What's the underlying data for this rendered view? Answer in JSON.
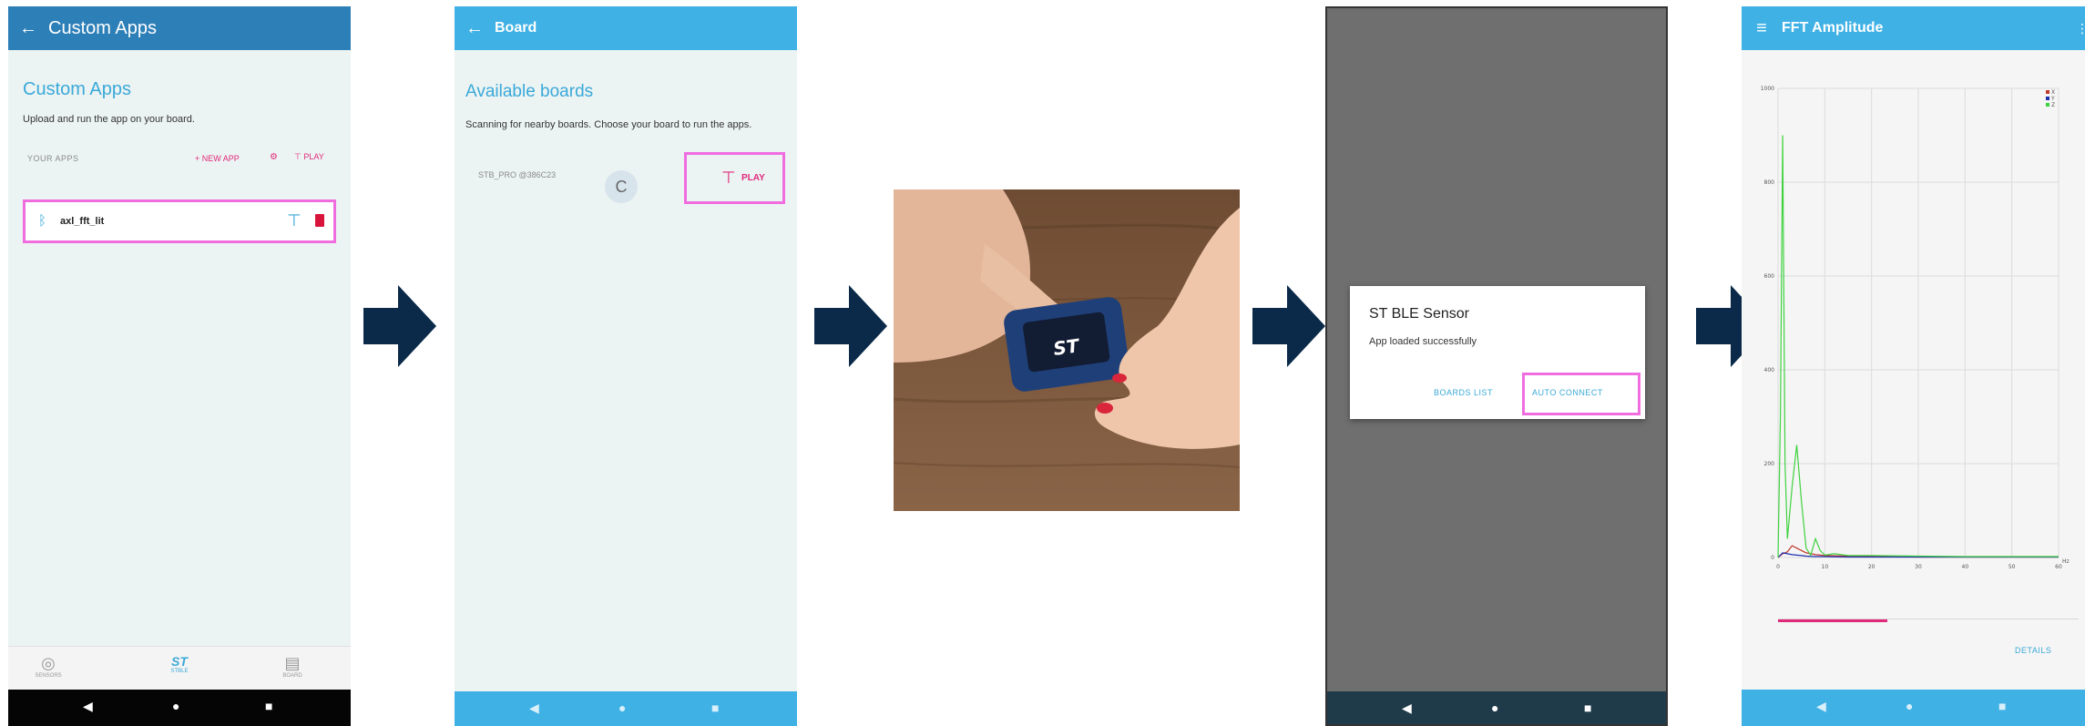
{
  "flow_arrow_color": "#0b2a4a",
  "panel1": {
    "appbar_title": "Custom Apps",
    "back_icon": "←",
    "heading": "Custom Apps",
    "subtitle": "Upload and run the app on your board.",
    "section_label": "YOUR APPS",
    "new_app_label": "+ NEW APP",
    "play_label": "PLAY",
    "app_name": "axl_fft_lit",
    "nav_items": [
      "SENSORS",
      "STBLE",
      "BOARD"
    ],
    "nav_active_label": "ST"
  },
  "panel2": {
    "appbar_title": "Board",
    "back_icon": "←",
    "heading": "Available boards",
    "subtitle": "Scanning for nearby boards. Choose your board to run the apps.",
    "board_name": "STB_PRO @386C23",
    "spinner_glyph": "C",
    "play_label": "PLAY"
  },
  "panel4": {
    "dialog_title": "ST BLE Sensor",
    "dialog_message": "App loaded successfully",
    "boards_list_label": "BOARDS LIST",
    "auto_connect_label": "AUTO CONNECT"
  },
  "panel5": {
    "appbar_title": "FFT Amplitude",
    "details_label": "DETAILS",
    "menu_icon": "≡",
    "overflow_icon": "⋮"
  },
  "system_nav": {
    "back_icon": "◀",
    "home_icon": "●",
    "recent_icon": "■"
  },
  "chart_data": {
    "type": "line",
    "title": "",
    "xlabel": "Hz",
    "ylabel": "",
    "ylim": [
      0,
      1000
    ],
    "yticks": [
      0,
      200,
      400,
      600,
      800,
      1000
    ],
    "xticks": [
      0,
      10,
      20,
      30,
      40,
      50,
      60
    ],
    "xlim": [
      0,
      60
    ],
    "legend_position": "top-right",
    "series": [
      {
        "name": "X",
        "color": "#c0392b",
        "x": [
          0,
          1,
          2,
          3,
          4,
          5,
          6,
          8,
          10,
          15,
          20,
          30,
          40,
          50,
          60
        ],
        "values": [
          0,
          8,
          12,
          25,
          20,
          15,
          10,
          6,
          4,
          3,
          2,
          1,
          1,
          1,
          1
        ]
      },
      {
        "name": "Y",
        "color": "#1f2fb0",
        "x": [
          0,
          1,
          2,
          3,
          4,
          5,
          6,
          8,
          10,
          15,
          20,
          30,
          40,
          50,
          60
        ],
        "values": [
          0,
          10,
          8,
          6,
          5,
          4,
          3,
          2,
          2,
          1,
          1,
          1,
          1,
          1,
          1
        ]
      },
      {
        "name": "Z",
        "color": "#3fd23f",
        "x": [
          0,
          0.5,
          1,
          1.5,
          2,
          3,
          4,
          5,
          6,
          7,
          8,
          9,
          10,
          12,
          15,
          20,
          30,
          40,
          50,
          60
        ],
        "values": [
          0,
          300,
          900,
          200,
          40,
          150,
          240,
          120,
          20,
          5,
          40,
          15,
          5,
          8,
          4,
          4,
          3,
          2,
          2,
          2
        ]
      }
    ]
  }
}
